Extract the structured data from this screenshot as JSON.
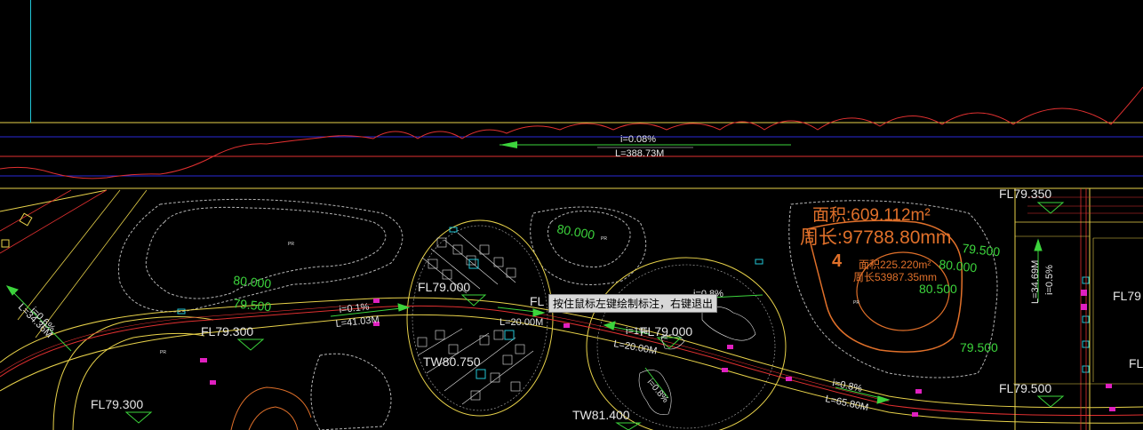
{
  "tooltip": "按住鼠标左键绘制标注，右键退出",
  "cursor_glyph": "FL",
  "road_labels": {
    "top_slope": "i=0.08%",
    "top_length": "L=388.73M",
    "left_slope": "i=0.6%",
    "left_length": "L=34.36M",
    "mid_slope_1": "i=0.1%",
    "mid_length_1": "L=41.03M",
    "mid_length_2": "L=20.00M",
    "mid_slope_2": "i=1%",
    "mid_length_3": "L=20.00M",
    "right_slope": "i=0.8%",
    "right_length": "L=65.80M",
    "upper_slope": "i=0.8%",
    "small_slope": "i=0.8%",
    "vertical_slope": "i=0.5%",
    "vertical_length": "L=34.69M"
  },
  "elevations": {
    "fl_79_350": "FL79.350",
    "fl_79_000_a": "FL79.000",
    "fl_79_000_b": "FL79.000",
    "fl_79_300_a": "FL79.300",
    "fl_79_300_b": "FL79.300",
    "fl_79_500": "FL79.500",
    "tw_80_750": "TW80.750",
    "tw_81_400": "TW81.400",
    "fl_right": "FL79",
    "fl_edge": "FL"
  },
  "contours": {
    "c80_top": "80.000",
    "c80_left": "80.000",
    "c79_5_left": "79.500",
    "c79_5_right": "79.500",
    "c80_right": "80.000",
    "c80_5_right": "80.500",
    "c79_5_bottom": "79.500"
  },
  "area_info": {
    "area_big": "面积:609.112m²",
    "perimeter_big": "周长:97788.80mm",
    "zone_number": "4",
    "area_small": "面积225.220m²",
    "perimeter_small": "周长53987.35mm"
  },
  "small_marks": [
    "PR",
    "PR",
    "PR",
    "PR",
    "PR"
  ],
  "colors": {
    "background": "#000000",
    "road_yellow": "#e8d24a",
    "road_red": "#e03030",
    "blue_line": "#2a2ad8",
    "contour_gray": "#b4b4b4",
    "label_green": "#3cd43c",
    "label_white": "#e6e6e6",
    "area_orange": "#e0702a",
    "magenta": "#e020c0",
    "cyan": "#22c6d6"
  }
}
